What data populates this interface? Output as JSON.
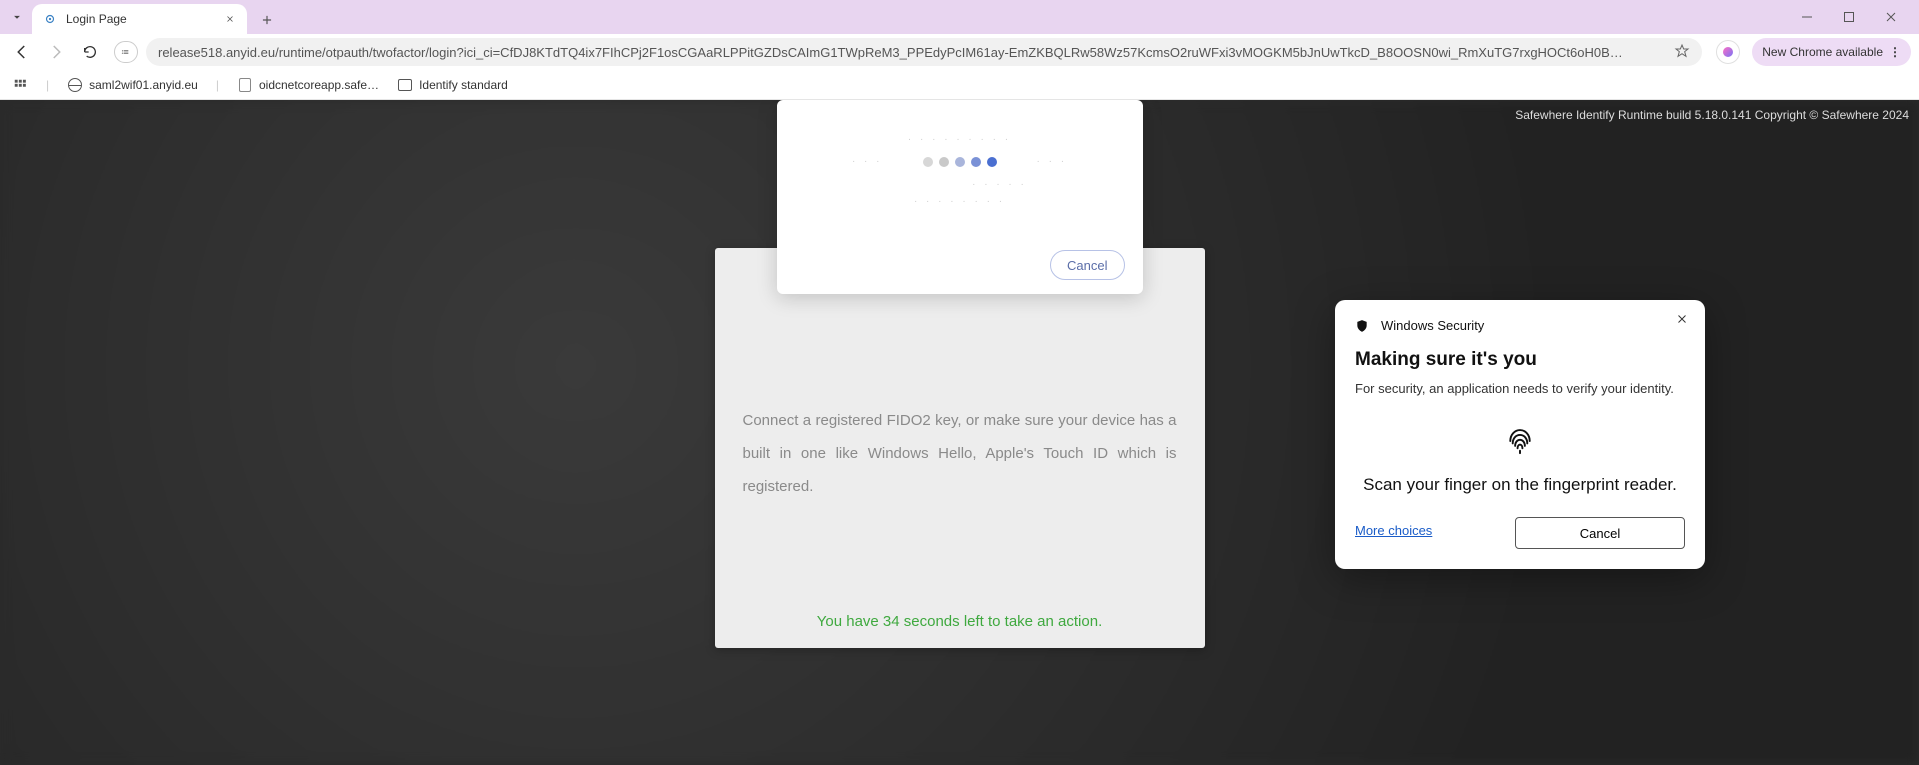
{
  "browser": {
    "tab_title": "Login Page",
    "url": "release518.anyid.eu/runtime/otpauth/twofactor/login?ici_ci=CfDJ8KTdTQ4ix7FIhCPj2F1osCGAaRLPPitGZDsCAImG1TWpReM3_PPEdyPcIM61ay-EmZKBQLRw58Wz57KcmsO2ruWFxi3vMOGKM5bJnUwTkcD_B8OOSN0wi_RmXuTG7rxgHOCt6oH0B…",
    "new_chrome": "New Chrome available"
  },
  "bookmarks": {
    "b1": "saml2wif01.anyid.eu",
    "b2": "oidcnetcoreapp.safe…",
    "b3": "Identify standard"
  },
  "page": {
    "copyright": "Safewhere Identify Runtime build 5.18.0.141 Copyright © Safewhere 2024",
    "fido_text": "Connect a registered FIDO2 key, or make sure your device has a built in one like Windows Hello, Apple's Touch ID which is registered.",
    "timer_text": "You have 34 seconds left to take an action."
  },
  "loading": {
    "cancel": "Cancel"
  },
  "ws": {
    "header": "Windows Security",
    "title": "Making sure it's you",
    "subtitle": "For security, an application needs to verify your identity.",
    "fingerprint_text": "Scan your finger on the fingerprint reader.",
    "more": "More choices",
    "cancel": "Cancel"
  }
}
